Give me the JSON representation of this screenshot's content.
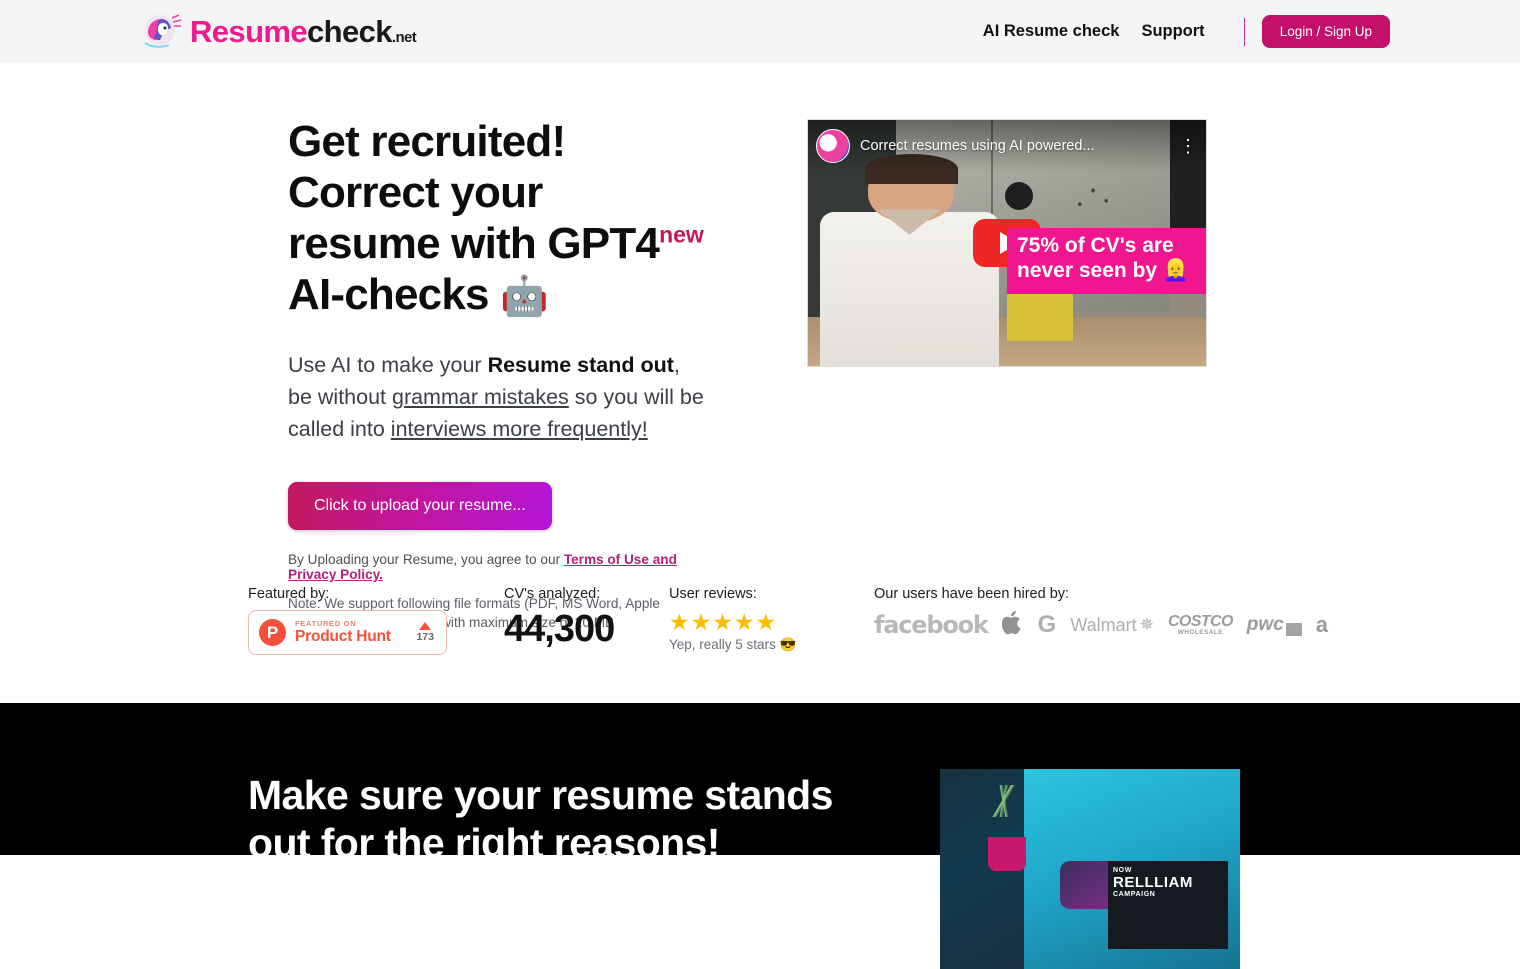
{
  "header": {
    "brand": {
      "part1": "Resume",
      "part2": "check",
      "part3": ".net",
      "icon": "resumecheck-logo-icon"
    },
    "nav": [
      {
        "label": "AI Resume check",
        "name": "nav-ai-resume-check"
      },
      {
        "label": "Support",
        "name": "nav-support"
      }
    ],
    "login_label": "Login / Sign Up",
    "accent": "#c3116b",
    "background": "#f5f5f5"
  },
  "hero": {
    "title_part1": "Get recruited! Correct your resume with GPT4",
    "title_badge": "new",
    "title_part2": " AI-checks ",
    "title_emoji": "🤖",
    "sub_part1": "Use AI to make your ",
    "sub_bold": "Resume stand out",
    "sub_part2": ", be without ",
    "sub_link1": "grammar mistakes",
    "sub_part3": " so you will be called into ",
    "sub_link2": "interviews more frequently!",
    "upload_button": "Click to upload your resume...",
    "terms_prefix": "By Uploading your Resume, you agree to our ",
    "terms_link": "Terms of Use and Privacy Policy.",
    "note": "Note: We support following file formats (PDF, MS Word, Apple Pages, RTF Documents) with maximum size of 20 MB"
  },
  "video": {
    "title": "Correct resumes using AI powered...",
    "caption": "75% of CV's are never seen by 👱‍♀️",
    "play_icon": "youtube-play-icon",
    "kebab_icon": "more-options-icon",
    "avatar_icon": "channel-avatar-icon"
  },
  "stats": {
    "featured_label": "Featured by:",
    "product_hunt": {
      "featured_on": "FEATURED ON",
      "name": "Product Hunt",
      "votes": "173",
      "logo_letter": "P"
    },
    "cvs_label": "CV's analyzed:",
    "cvs_value": "44,300",
    "reviews_label": "User reviews:",
    "stars": "★★★★★",
    "stars_count": 5,
    "reviews_note": "Yep, really 5 stars 😎",
    "hired_label": "Our users have been hired by:",
    "hired_logos": [
      {
        "name": "facebook-logo",
        "text": "facebook"
      },
      {
        "name": "apple-logo",
        "text": ""
      },
      {
        "name": "google-logo",
        "text": "G"
      },
      {
        "name": "walmart-logo",
        "text": "Walmart"
      },
      {
        "name": "costco-logo",
        "text": "COSTCO",
        "sub": "WHOLESALE"
      },
      {
        "name": "pwc-logo",
        "text": "pwc"
      },
      {
        "name": "amazon-logo",
        "text": "a"
      }
    ]
  },
  "dark": {
    "title": "Make sure your resume stands out for the right reasons!",
    "photo_card_top": "NOW",
    "photo_card_big": "RELLLIAM",
    "photo_card_sub": "CAMPAIGN"
  }
}
